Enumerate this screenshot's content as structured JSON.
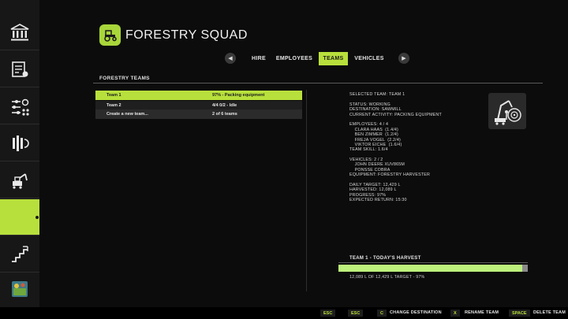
{
  "app": {
    "title": "FORESTRY SQUAD"
  },
  "tabs": [
    {
      "label": "HIRE"
    },
    {
      "label": "EMPLOYEES"
    },
    {
      "label": "TEAMS",
      "active": true
    },
    {
      "label": "VEHICLES"
    }
  ],
  "section": {
    "title": "FORESTRY TEAMS"
  },
  "teams": [
    {
      "name": "Team 1",
      "status": "97%  -  Packing equipment",
      "selected": true
    },
    {
      "name": "Team 2",
      "status": "4/4  0/2  -  Idle"
    }
  ],
  "create_row": {
    "label": "Create a new team...",
    "count": "2 of 6 teams"
  },
  "details": {
    "lines": [
      "SELECTED TEAM: TEAM 1",
      "",
      "STATUS: WORKING",
      "DESTINATION: SAWMILL",
      "CURRENT ACTIVITY: PACKING EQUIPMENT",
      "",
      "EMPLOYEES: 4 / 4",
      "    CLARA HAAS  (1.4/4)",
      "    BEN ZIMMER  (1.2/4)",
      "    FREJA VOGEL  (2.2/4)",
      "    VIKTOR EICHE  (1.6/4)",
      "TEAM SKILL: 1.6/4",
      "",
      "VEHICLES: 2 / 2",
      "    JOHN DEERE XUV865M",
      "    PONSSE COBRA",
      "EQUIPMENT: FORESTRY HARVESTER",
      "",
      "DAILY TARGET: 12,429 L",
      "HARVESTED: 12,089 L",
      "PROGRESS: 97%",
      "EXPECTED RETURN: 15:30"
    ]
  },
  "harvest": {
    "title": "TEAM 1  -  TODAY'S HARVEST",
    "progress": 0.97,
    "text": "12,089 L OF 12,429 L TARGET  -  97%"
  },
  "footer": {
    "actions": [
      {
        "key": "ESC",
        "label": ""
      },
      {
        "key": "ESC",
        "label": ""
      },
      {
        "key": "C",
        "label": "CHANGE DESTINATION"
      },
      {
        "key": "X",
        "label": "RENAME TEAM"
      },
      {
        "key": "SPACE",
        "label": "DELETE TEAM"
      }
    ]
  },
  "colors": {
    "accent": "#b8e03c",
    "progress_fill": "#bdf07c",
    "background": "#0c0c0c",
    "sidebar": "#171717"
  },
  "sidebar_icons": [
    "chevron-down-icon",
    "bank-icon",
    "contract-icon",
    "settings-sliders-icon",
    "production-chain-icon",
    "excavator-icon",
    "active-menu-item",
    "stairs-growth-icon",
    "farm-map-icon"
  ]
}
